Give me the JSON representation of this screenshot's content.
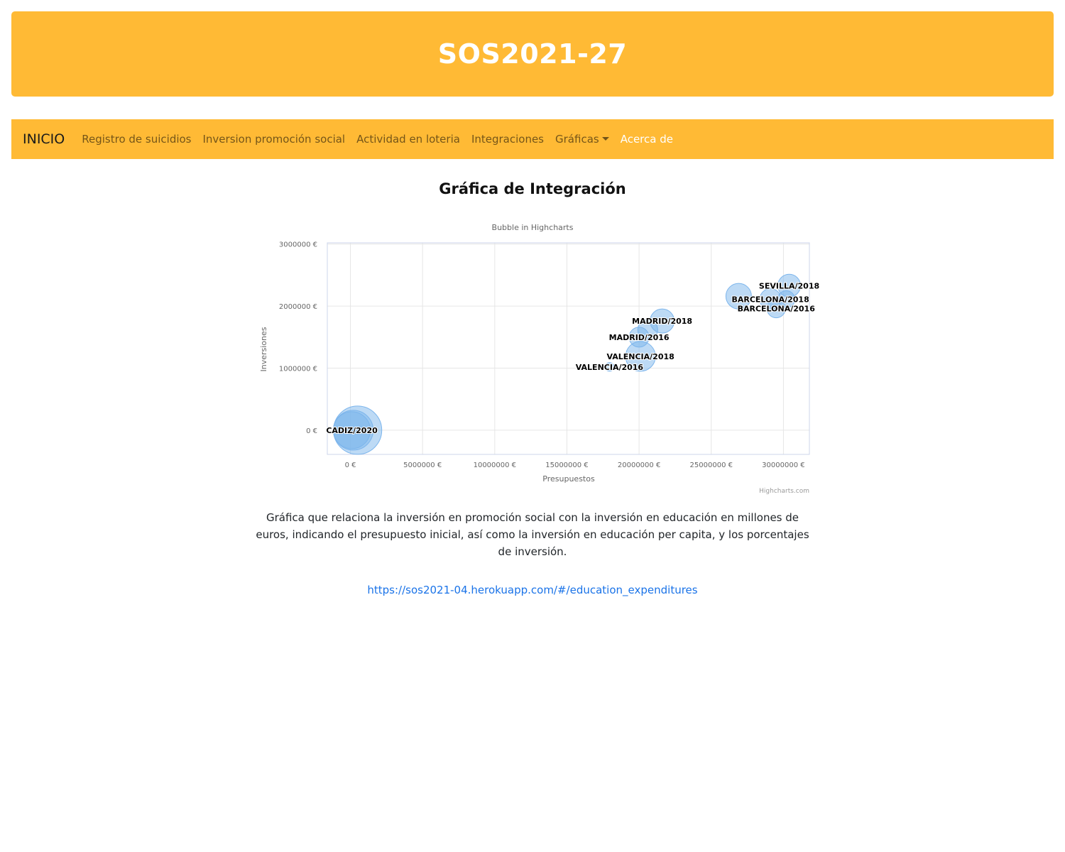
{
  "header": {
    "title": "SOS2021-27"
  },
  "nav": {
    "brand": "INICIO",
    "items": [
      "Registro de suicidios",
      "Inversion promoción social",
      "Actividad en loteria",
      "Integraciones",
      "Gráficas",
      "Acerca de"
    ]
  },
  "main": {
    "title": "Gráfica de Integración",
    "description": "Gráfica que relaciona la inversión en promoción social con la inversión en educación en millones de euros, indicando el presupuesto inicial, así como la inversión en educación per capita, y los porcentajes de inversión.",
    "link": "https://sos2021-04.herokuapp.com/#/education_expenditures"
  },
  "chart_data": {
    "type": "bubble",
    "title": "",
    "subtitle": "Bubble in Highcharts",
    "xlabel": "Presupuestos",
    "ylabel": "Inversiones",
    "credits": "Highcharts.com",
    "xlim": [
      -1600000,
      31800000
    ],
    "ylim": [
      -390000,
      3020000
    ],
    "x_ticks": [
      0,
      5000000,
      10000000,
      15000000,
      20000000,
      25000000,
      30000000
    ],
    "y_ticks": [
      0,
      1000000,
      2000000,
      3000000
    ],
    "x_tick_labels": [
      "0 €",
      "5000000 €",
      "10000000 €",
      "15000000 €",
      "20000000 €",
      "25000000 €",
      "30000000 €"
    ],
    "y_tick_labels": [
      "0 €",
      "1000000 €",
      "2000000 €",
      "3000000 €"
    ],
    "grid": true,
    "bubble_color": "#7cb5ec",
    "points": [
      {
        "x": 500000,
        "y": 0,
        "z": 34,
        "label": ""
      },
      {
        "x": 200000,
        "y": 0,
        "z": 28,
        "label": ""
      },
      {
        "x": 100000,
        "y": 0,
        "z": 26,
        "label": "CADIZ/2020"
      },
      {
        "x": 17950000,
        "y": 1020000,
        "z": 6,
        "label": "VALENCIA/2016"
      },
      {
        "x": 20100000,
        "y": 1190000,
        "z": 21,
        "label": "VALENCIA/2018"
      },
      {
        "x": 20000000,
        "y": 1500000,
        "z": 14,
        "label": "MADRID/2016"
      },
      {
        "x": 20600000,
        "y": 1620000,
        "z": 14,
        "label": ""
      },
      {
        "x": 21600000,
        "y": 1760000,
        "z": 17,
        "label": "MADRID/2018"
      },
      {
        "x": 26900000,
        "y": 2160000,
        "z": 18,
        "label": ""
      },
      {
        "x": 29500000,
        "y": 1960000,
        "z": 13,
        "label": "BARCELONA/2016"
      },
      {
        "x": 29100000,
        "y": 2110000,
        "z": 15,
        "label": "BARCELONA/2018"
      },
      {
        "x": 30400000,
        "y": 2330000,
        "z": 16,
        "label": "SEVILLA/2018"
      },
      {
        "x": 30200000,
        "y": 2110000,
        "z": 12,
        "label": ""
      }
    ]
  }
}
